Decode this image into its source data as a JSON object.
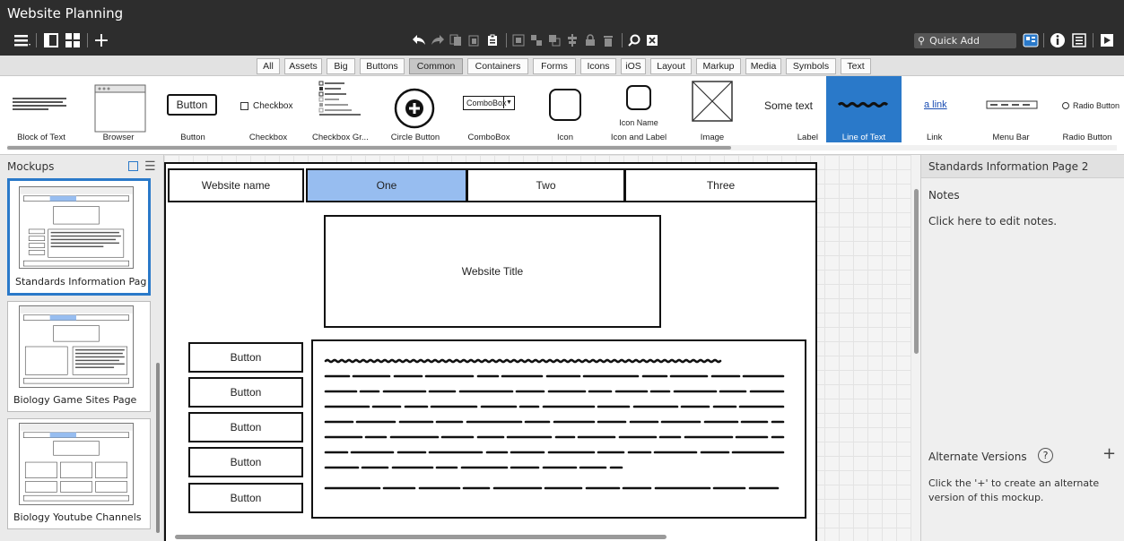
{
  "app": {
    "title": "Website Planning"
  },
  "toolbar": {
    "quick_add": "Quick Add"
  },
  "filters": [
    "All",
    "Assets",
    "Big",
    "Buttons",
    "Common",
    "Containers",
    "Forms",
    "Icons",
    "iOS",
    "Layout",
    "Markup",
    "Media",
    "Symbols",
    "Text"
  ],
  "active_filter": "Common",
  "library": {
    "items": [
      "Block of Text",
      "Browser",
      "Button",
      "Checkbox",
      "Checkbox Gr...",
      "Circle Button",
      "ComboBox",
      "Icon",
      "Icon and Label",
      "Image",
      "Label",
      "Line of Text",
      "Link",
      "Menu Bar",
      "Radio Button"
    ],
    "selected": "Line of Text",
    "button_text": "Button",
    "checkbox_text": "Checkbox",
    "combobox_text": "ComboBox",
    "icon_name_text": "Icon Name",
    "label_text": "Some text",
    "link_text": "a link",
    "radio_text": "Radio Button"
  },
  "mockups": {
    "title": "Mockups",
    "pages": [
      "Standards Information Page",
      "Biology Game Sites Page",
      "Biology Youtube Channels"
    ],
    "selected_index": 0
  },
  "canvas": {
    "nav": [
      "Website name",
      "One",
      "Two",
      "Three"
    ],
    "active_nav": "One",
    "title_box": "Website Title",
    "buttons": [
      "Button",
      "Button",
      "Button",
      "Button",
      "Button"
    ]
  },
  "properties": {
    "title": "Standards Information Page 2",
    "notes_label": "Notes",
    "notes_placeholder": "Click here to edit notes.",
    "alt_versions_label": "Alternate Versions",
    "alt_versions_help": "Click the '+' to create an alternate version of this mockup."
  },
  "colors": {
    "accent": "#2a79c9",
    "active_nav": "#97bdf0",
    "topbar": "#2d2d2d"
  }
}
